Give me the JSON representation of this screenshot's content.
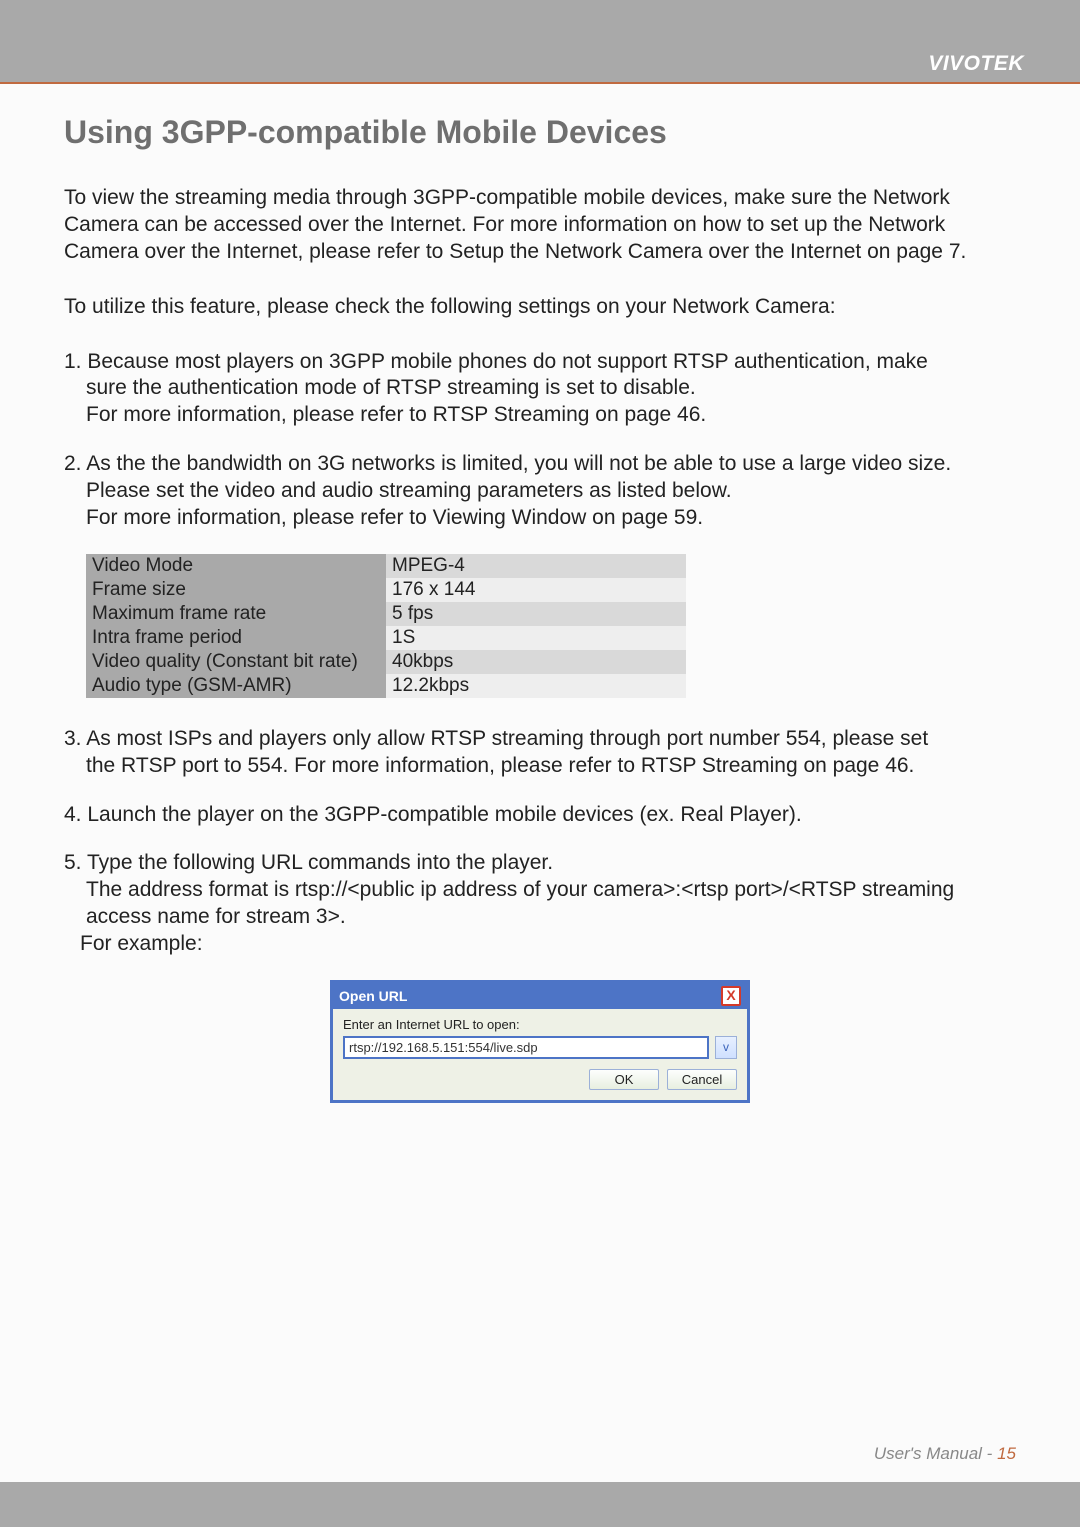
{
  "brand": "VIVOTEK",
  "heading": "Using 3GPP-compatible Mobile Devices",
  "intro": "To view the streaming media through 3GPP-compatible mobile devices, make sure the Network Camera can be accessed over the Internet. For more information on how to set up the Network Camera over the Internet, please refer to Setup the Network Camera over the Internet on page 7.",
  "lead": "To utilize this feature, please check the following settings on your Network Camera:",
  "items": {
    "i1_l1": "1. Because most players on 3GPP mobile phones do not support RTSP authentication, make",
    "i1_l2": "sure the authentication mode of RTSP streaming is set to disable.",
    "i1_l3": "For more information, please refer to RTSP Streaming on page 46.",
    "i2_l1": "2. As the the bandwidth on 3G networks is limited, you will not be able to use a large video size.",
    "i2_l2": "Please set the video and audio streaming parameters as listed below.",
    "i2_l3": "For more information, please refer to Viewing Window on page 59.",
    "i3_l1": "3. As most ISPs and players only allow RTSP streaming through port number 554, please set",
    "i3_l2": "the RTSP port to 554. For more information, please refer to RTSP Streaming on page 46.",
    "i4": "4. Launch the player on the 3GPP-compatible mobile devices (ex. Real Player).",
    "i5_l1": "5. Type the following URL commands into the player.",
    "i5_l2": "The address format is rtsp://<public ip address of your camera>:<rtsp port>/<RTSP streaming",
    "i5_l3": "access name for stream 3>.",
    "i5_l4": "For example:"
  },
  "table": [
    {
      "label": "Video Mode",
      "value": "MPEG-4"
    },
    {
      "label": "Frame size",
      "value": "176 x 144"
    },
    {
      "label": "Maximum frame rate",
      "value": "5 fps"
    },
    {
      "label": "Intra frame period",
      "value": "1S"
    },
    {
      "label": "Video quality (Constant bit rate)",
      "value": "40kbps"
    },
    {
      "label": "Audio type (GSM-AMR)",
      "value": "12.2kbps"
    }
  ],
  "dialog": {
    "title": "Open URL",
    "close": "X",
    "label": "Enter an Internet URL to open:",
    "url": "rtsp://192.168.5.151:554/live.sdp",
    "ok": "OK",
    "cancel": "Cancel",
    "dropdown_glyph": "v"
  },
  "footer": {
    "text": "User's Manual - ",
    "page": "15"
  }
}
